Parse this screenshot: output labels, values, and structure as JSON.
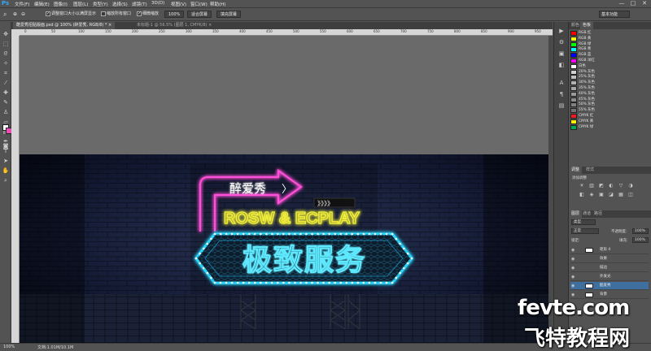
{
  "app": {
    "logo": "Ps"
  },
  "menu": [
    "文件(F)",
    "编辑(E)",
    "图像(I)",
    "图层(L)",
    "类型(Y)",
    "选择(S)",
    "滤镜(T)",
    "3D(D)",
    "视图(V)",
    "窗口(W)",
    "帮助(H)"
  ],
  "window_controls": [
    "—",
    "□",
    "✕"
  ],
  "options": {
    "resize_windows": "调整窗口大小以满屏显示",
    "zoom_all": "缩放所有窗口",
    "scrubby_zoom": "细微缩放",
    "btn_100": "100%",
    "btn_fit": "适合屏幕",
    "btn_fill": "填充屏幕",
    "workspace": "基本功能"
  },
  "tabs": [
    {
      "label": "酷爱秀招贴版面.psd @ 100% (醉爱秀, RGB/8) * ×"
    },
    {
      "label": "未标题-1 @ 56.5% (图层 1, CMYK/8) ×"
    }
  ],
  "ruler_ticks": [
    "0",
    "50",
    "100",
    "150",
    "200",
    "250",
    "300",
    "350",
    "400",
    "450",
    "500",
    "550",
    "600",
    "650",
    "700",
    "750",
    "800",
    "850",
    "900",
    "950"
  ],
  "canvas_art": {
    "sign_top": "醉爱秀",
    "sign_arrow": "〉",
    "chevrons": "》》》》",
    "brand": "ROSW & ECPLAY",
    "main": "极致服务",
    "colors": {
      "pink": "#ff4fd8",
      "yellow": "#f5f23a",
      "cyan": "#2fd8ff",
      "bg": "#0b1028"
    }
  },
  "status": {
    "zoom": "100%",
    "doc": "文档:1.01M/10.1M"
  },
  "right_icons": [
    "▶",
    "⚙",
    "▣",
    "◧",
    "A",
    "¶",
    "▤"
  ],
  "swatches": {
    "tabs": [
      "颜色",
      "色板"
    ],
    "items": [
      {
        "name": "RGB 红",
        "color": "#ff0000"
      },
      {
        "name": "RGB 黄",
        "color": "#ffff00"
      },
      {
        "name": "RGB 绿",
        "color": "#00ff00"
      },
      {
        "name": "RGB 青",
        "color": "#00ffff"
      },
      {
        "name": "RGB 蓝",
        "color": "#0000ff"
      },
      {
        "name": "RGB 洋红",
        "color": "#ff00ff"
      },
      {
        "name": "白色",
        "color": "#ffffff"
      },
      {
        "name": "20% 灰色",
        "color": "#d0d0d0"
      },
      {
        "name": "25% 灰色",
        "color": "#c0c0c0"
      },
      {
        "name": "30% 灰色",
        "color": "#b3b3b3"
      },
      {
        "name": "35% 灰色",
        "color": "#a6a6a6"
      },
      {
        "name": "40% 灰色",
        "color": "#999999"
      },
      {
        "name": "45% 灰色",
        "color": "#8c8c8c"
      },
      {
        "name": "50% 灰色",
        "color": "#808080"
      },
      {
        "name": "55% 灰色",
        "color": "#737373"
      },
      {
        "name": "CMYK 红",
        "color": "#ed1c24"
      },
      {
        "name": "CMYK 黄",
        "color": "#fff200"
      },
      {
        "name": "CMYK 绿",
        "color": "#00a651"
      }
    ]
  },
  "adjustments": {
    "tabs": [
      "调整",
      "样式"
    ],
    "title": "添加调整"
  },
  "layers": {
    "tabs": [
      "图层",
      "通道",
      "路径"
    ],
    "kind": "类型",
    "blend": "正常",
    "opacity_label": "不透明度:",
    "opacity": "100%",
    "lock_label": "锁定:",
    "fill_label": "填充:",
    "fill": "100%",
    "rows": [
      "矩形 4",
      "效果",
      "描边",
      "外发光",
      "酷爱秀",
      "背景"
    ]
  }
}
